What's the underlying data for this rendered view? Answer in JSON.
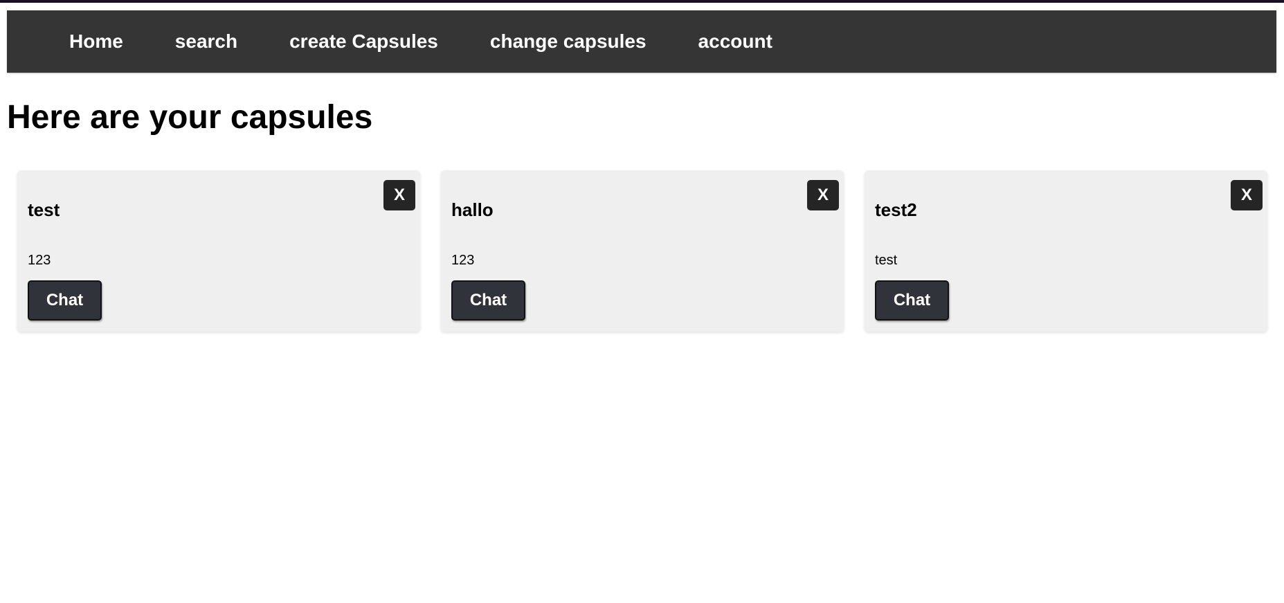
{
  "nav": {
    "items": [
      {
        "label": "Home"
      },
      {
        "label": "search"
      },
      {
        "label": "create Capsules"
      },
      {
        "label": "change capsules"
      },
      {
        "label": "account"
      }
    ]
  },
  "main": {
    "title": "Here are your capsules",
    "capsules": [
      {
        "title": "test",
        "description": "123",
        "chat_label": "Chat",
        "close_label": "X"
      },
      {
        "title": "hallo",
        "description": "123",
        "chat_label": "Chat",
        "close_label": "X"
      },
      {
        "title": "test2",
        "description": "test",
        "chat_label": "Chat",
        "close_label": "X"
      }
    ]
  },
  "colors": {
    "navbar_bg": "#353535",
    "card_bg": "#efefef",
    "button_bg": "#30343a",
    "close_bg": "#252525",
    "top_strip": "#1a0f24"
  }
}
